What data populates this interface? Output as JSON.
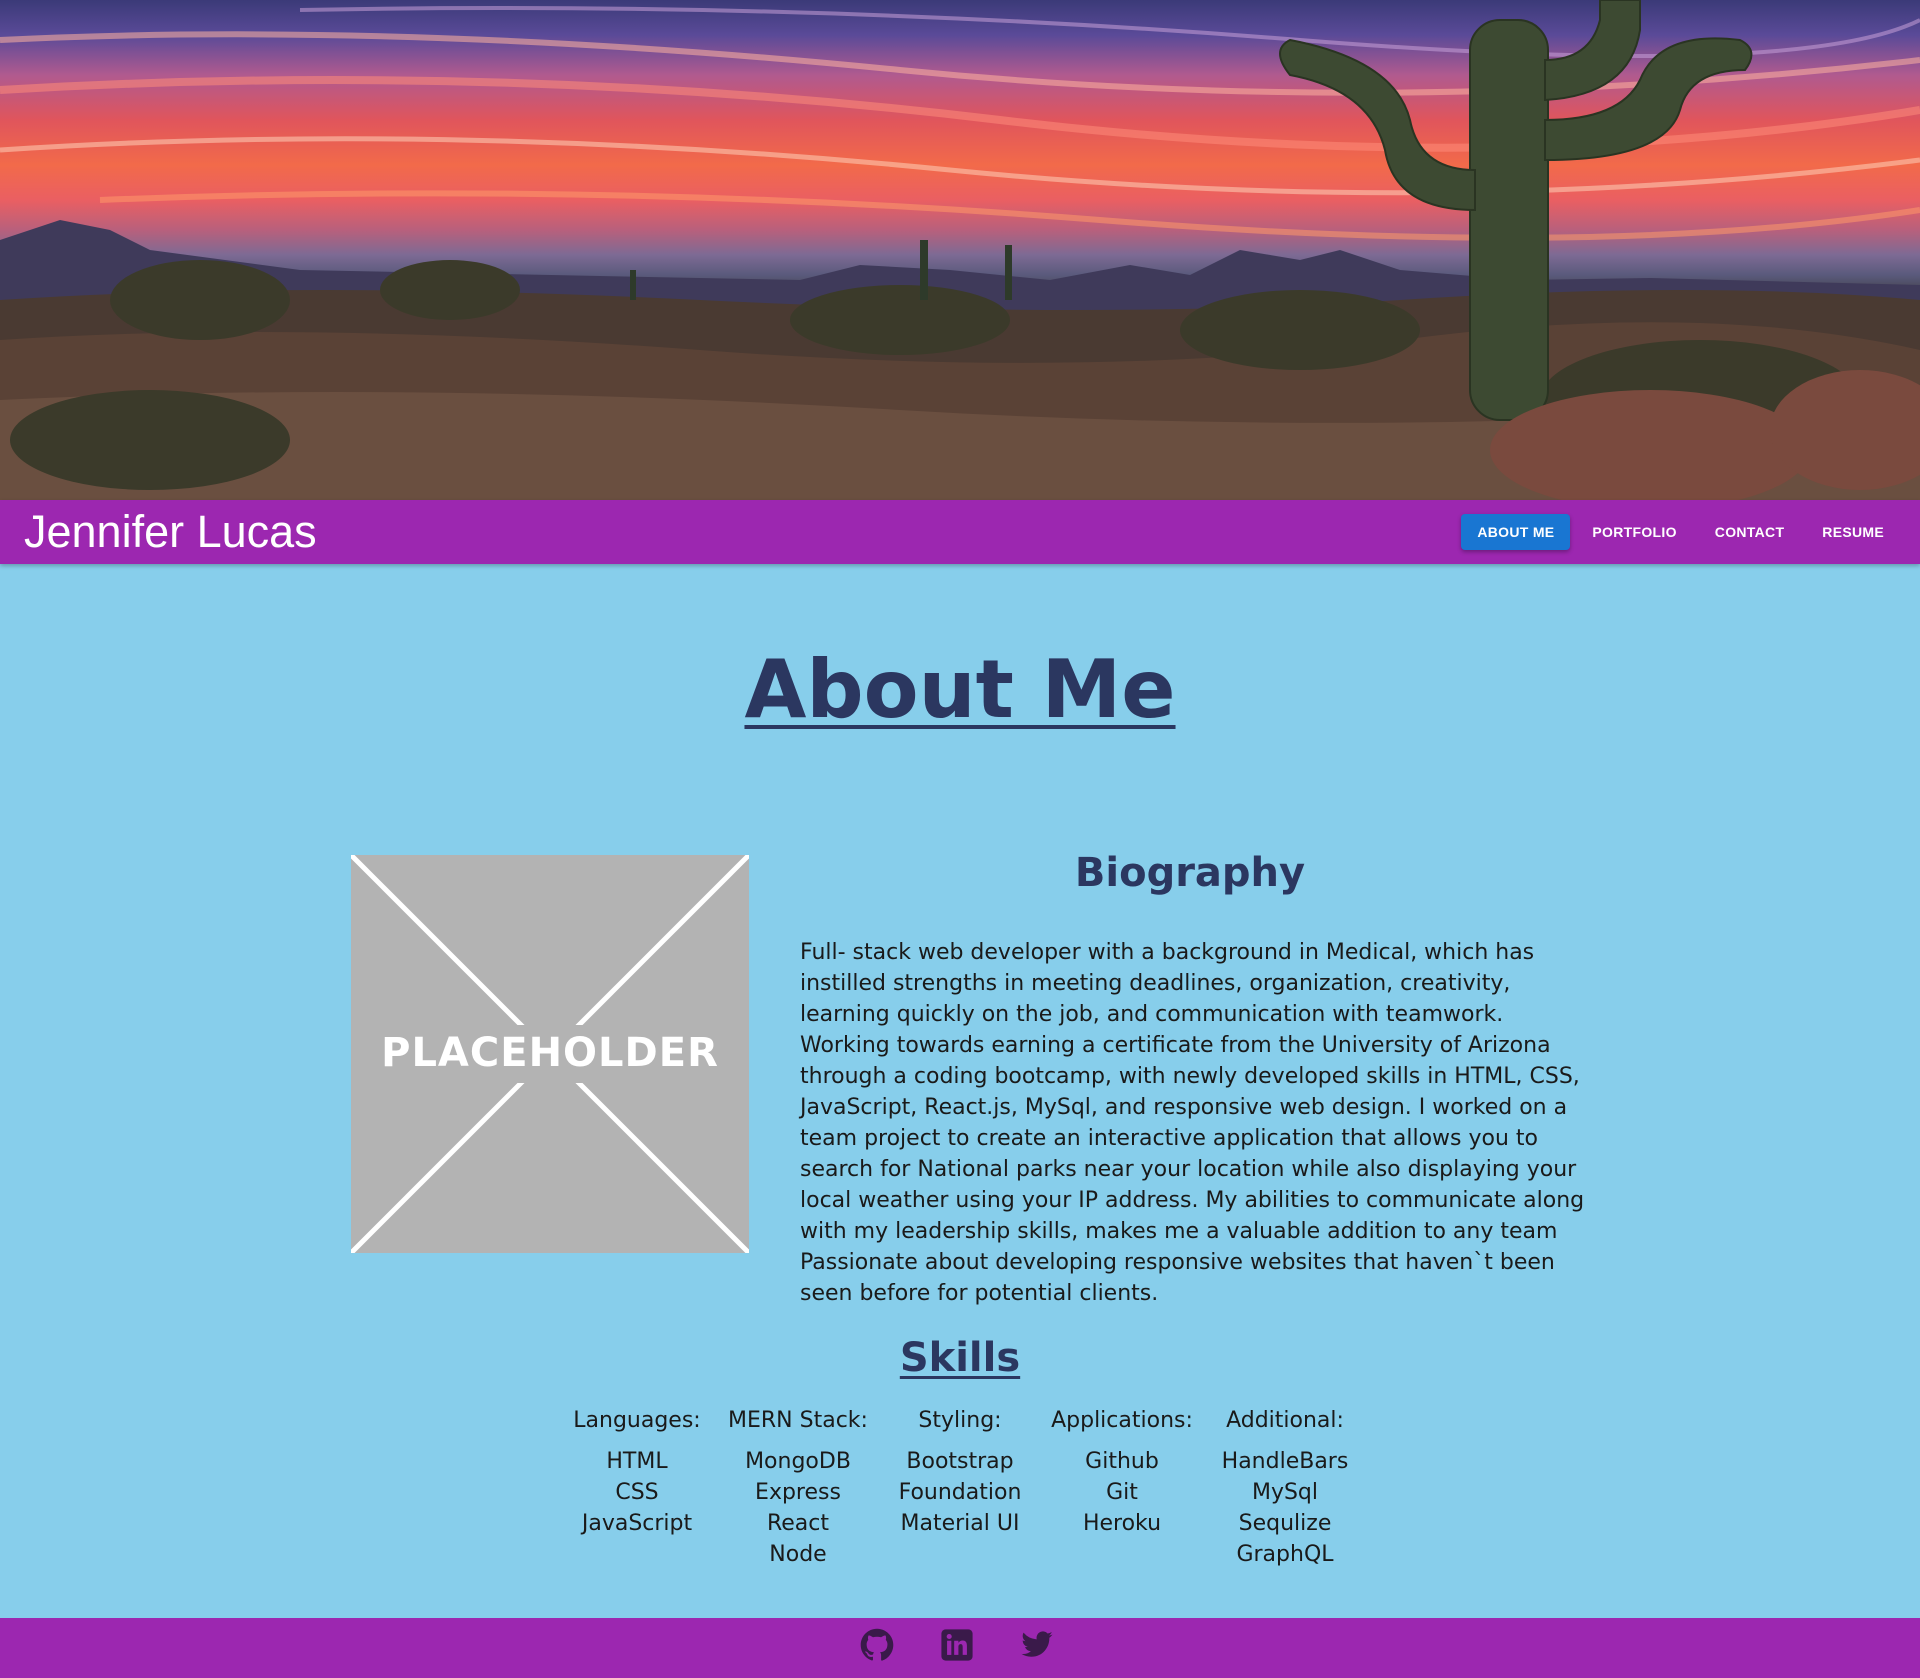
{
  "header": {
    "brand": "Jennifer Lucas",
    "nav": [
      {
        "label": "ABOUT ME",
        "active": true
      },
      {
        "label": "PORTFOLIO",
        "active": false
      },
      {
        "label": "CONTACT",
        "active": false
      },
      {
        "label": "RESUME",
        "active": false
      }
    ]
  },
  "about": {
    "title": "About Me",
    "placeholder_text": "PLACEHOLDER",
    "bio_heading": "Biography",
    "bio_text": "Full- stack web developer with a background in Medical, which has instilled strengths in meeting deadlines, organization, creativity, learning quickly on the job, and communication with teamwork. Working towards earning a certificate from the University of Arizona through a coding bootcamp, with newly developed skills in HTML, CSS, JavaScript, React.js, MySql, and responsive web design. I worked on a team project to create an interactive application that allows you to search for National parks near your location while also displaying your local weather using your IP address. My abilities to communicate along with my leadership skills, makes me a valuable addition to any team Passionate about developing responsive websites that haven`t been seen before for potential clients."
  },
  "skills": {
    "heading": "Skills",
    "columns": [
      {
        "title": "Languages:",
        "items": [
          "HTML",
          "CSS",
          "JavaScript"
        ]
      },
      {
        "title": "MERN Stack:",
        "items": [
          "MongoDB",
          "Express",
          "React",
          "Node"
        ]
      },
      {
        "title": "Styling:",
        "items": [
          "Bootstrap",
          "Foundation",
          "Material UI"
        ]
      },
      {
        "title": "Applications:",
        "items": [
          "Github",
          "Git",
          "Heroku"
        ]
      },
      {
        "title": "Additional:",
        "items": [
          "HandleBars",
          "MySql",
          "Sequlize",
          "GraphQL"
        ]
      }
    ]
  },
  "footer": {
    "icons": [
      "github-icon",
      "linkedin-icon",
      "twitter-icon"
    ]
  },
  "colors": {
    "nav_bg": "#9c27b0",
    "active_button": "#1976d2",
    "page_bg": "#87ceeb",
    "heading": "#2b3760"
  }
}
